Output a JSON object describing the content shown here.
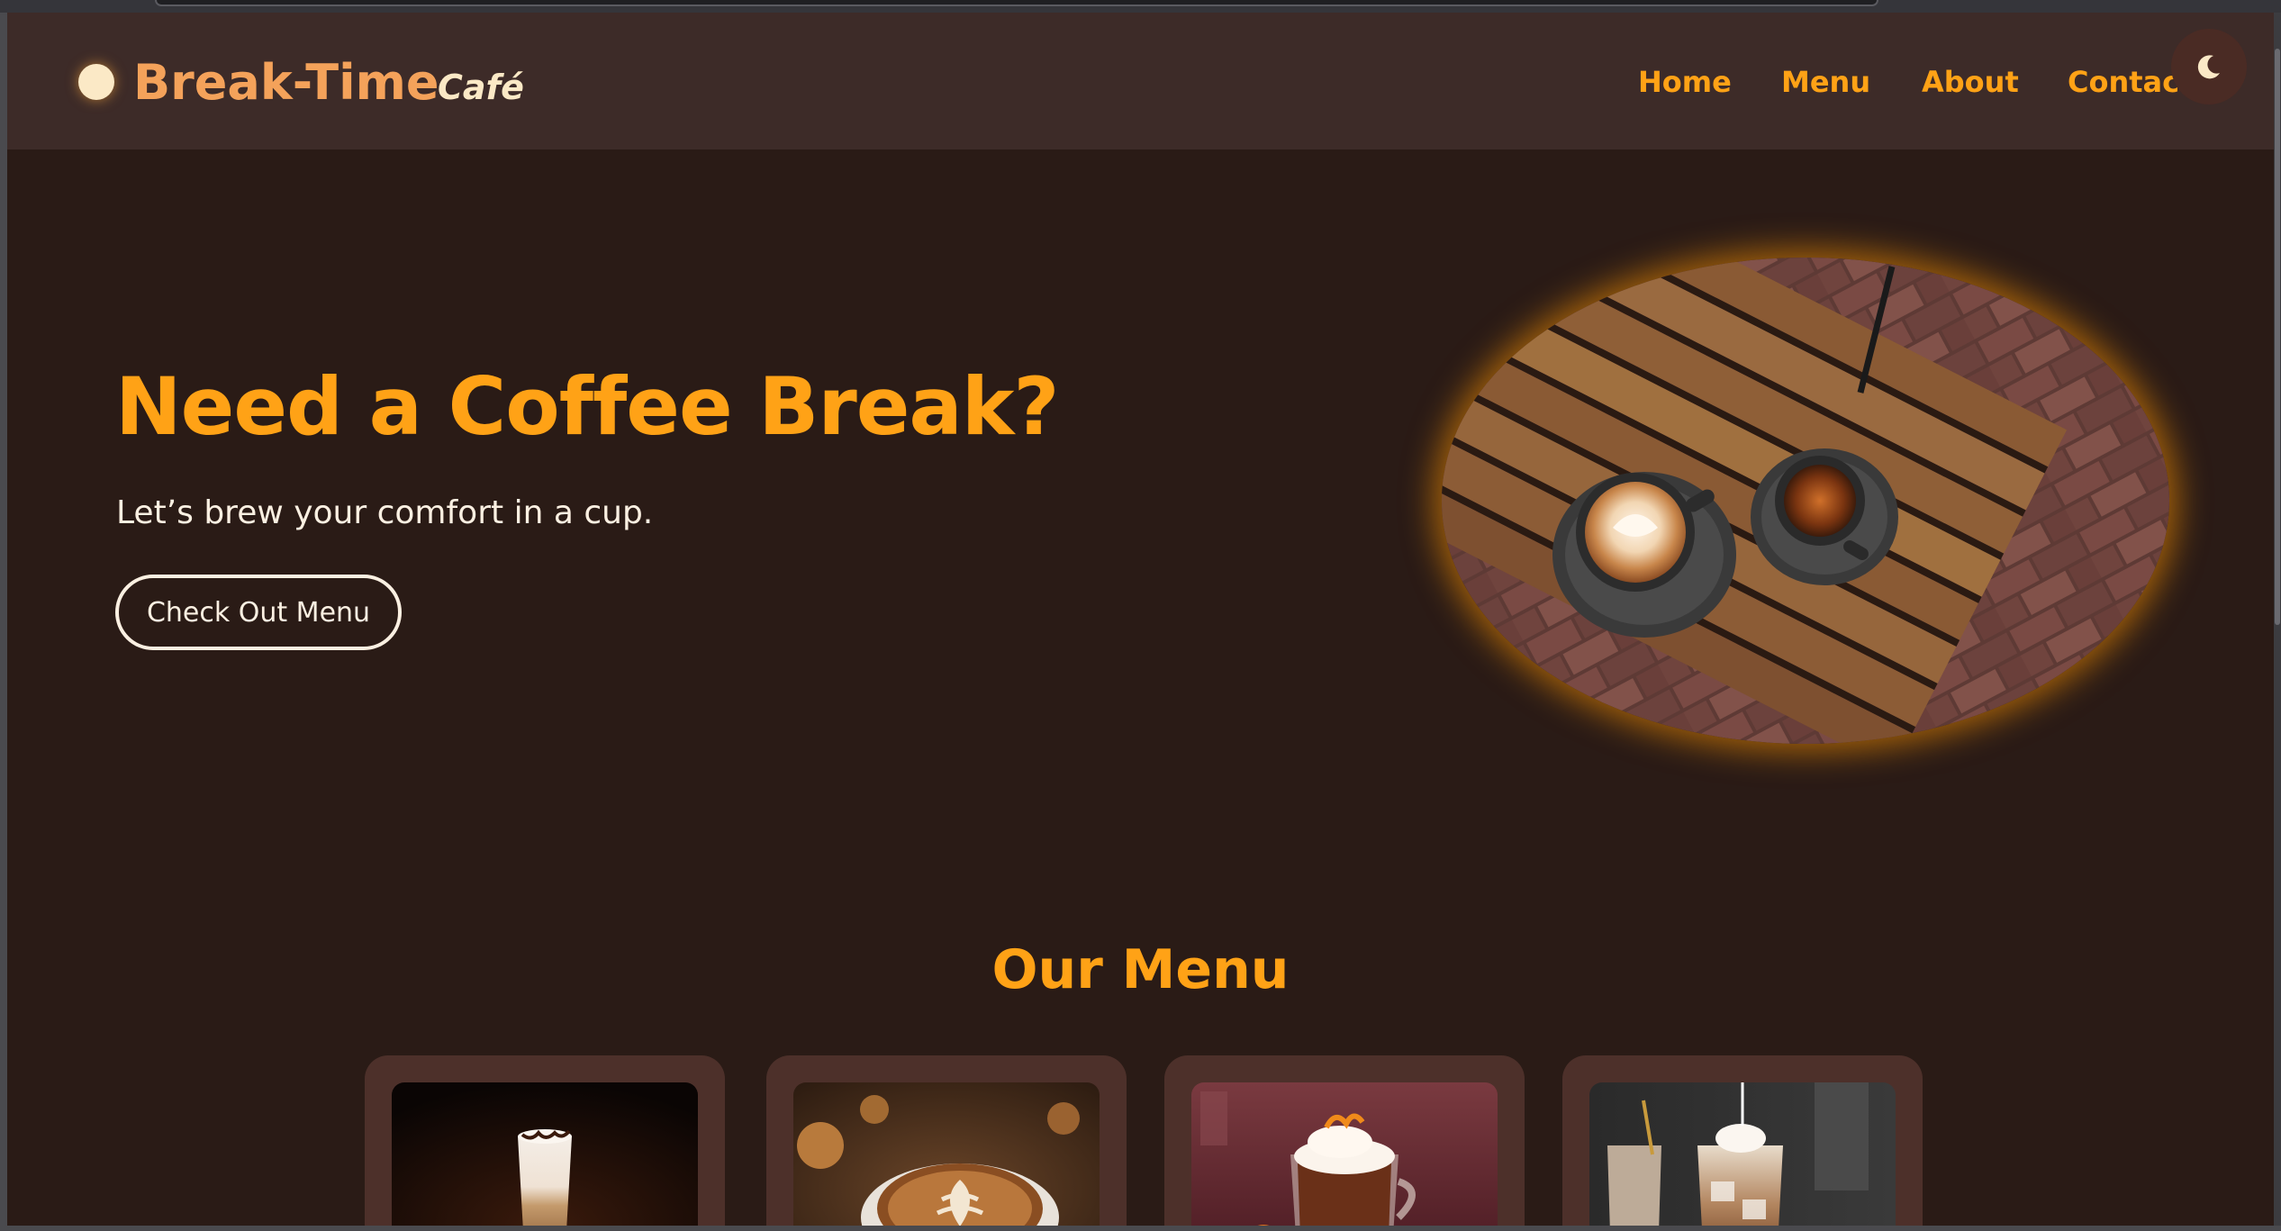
{
  "brand": {
    "name": "Break-Time",
    "suffix": "Café"
  },
  "nav": {
    "items": [
      {
        "label": "Home"
      },
      {
        "label": "Menu"
      },
      {
        "label": "About"
      },
      {
        "label": "Contact"
      }
    ],
    "theme_toggle_icon": "moon-icon"
  },
  "hero": {
    "title": "Need a Coffee Break?",
    "subtitle": "Let’s brew your comfort in a cup.",
    "cta_label": "Check Out Menu",
    "image": "coffee-cups-on-wooden-table"
  },
  "menu_section": {
    "title": "Our Menu",
    "items": [
      {
        "image": "layered-latte-glass"
      },
      {
        "image": "latte-art-cup"
      },
      {
        "image": "orange-hot-chocolate"
      },
      {
        "image": "iced-coffee-drinks"
      }
    ]
  },
  "colors": {
    "background": "#2a1b16",
    "navbar": "#3d2b28",
    "accent": "#ffa216",
    "logo": "#f4a25a",
    "card": "#4d302a",
    "text_light": "#fbf0e2"
  }
}
